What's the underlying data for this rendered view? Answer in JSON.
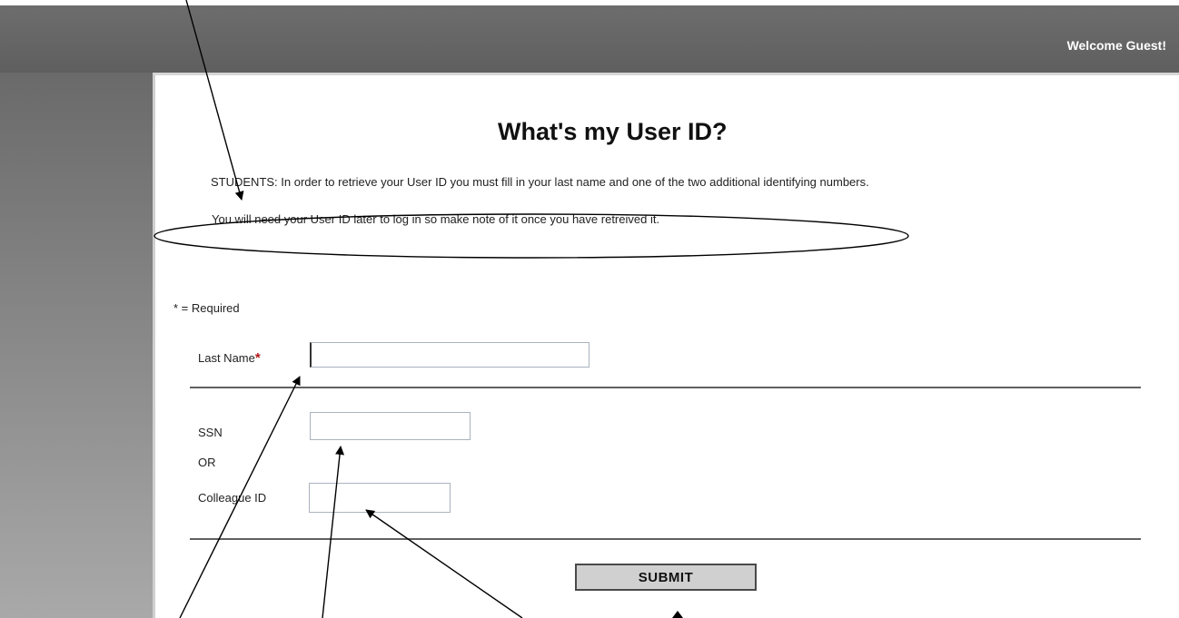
{
  "header": {
    "welcome": "Welcome Guest!"
  },
  "page": {
    "title": "What's my User ID?",
    "intro": "STUDENTS: In order to retrieve your User ID you must fill in your last name and one of the two additional identifying numbers.",
    "note": "You will need your User ID later to log in so make note of it once you have retreived it.",
    "required_note": "* = Required"
  },
  "form": {
    "last_name_label": "Last Name",
    "required_mark": "*",
    "last_name_value": "",
    "ssn_label": "SSN",
    "or_label": "OR",
    "colleague_id_label": "Colleague ID",
    "ssn_value": "",
    "colleague_id_value": "",
    "submit_label": "SUBMIT"
  },
  "colors": {
    "header_bg": "#666666",
    "required_star": "#b01818",
    "annotation": "#000000"
  }
}
